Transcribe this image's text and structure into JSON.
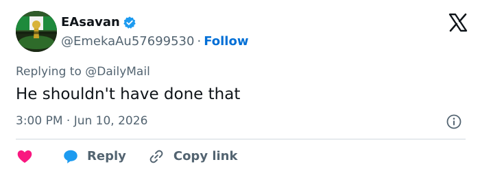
{
  "user": {
    "display_name": "EAsavan",
    "handle": "@EmekaAu57699530",
    "separator": "·",
    "follow_label": "Follow",
    "verified_color": "#1d9bf0"
  },
  "tweet": {
    "reply_prefix": "Replying to ",
    "reply_handle": "@DailyMail",
    "text": "He shouldn't have done that",
    "timestamp": "3:00 PM · Jun 10, 2026"
  },
  "actions": {
    "reply_label": "Reply",
    "copy_link_label": "Copy link"
  },
  "icons": {
    "logo": "x-logo-icon",
    "verified": "verified-badge-icon",
    "info": "info-icon",
    "like": "heart-icon",
    "reply": "speech-bubble-icon",
    "copy": "link-icon"
  },
  "colors": {
    "accent": "#006fd6",
    "like": "#f91880",
    "reply": "#1d9bf0",
    "muted": "#536471",
    "text": "#0f1419"
  }
}
